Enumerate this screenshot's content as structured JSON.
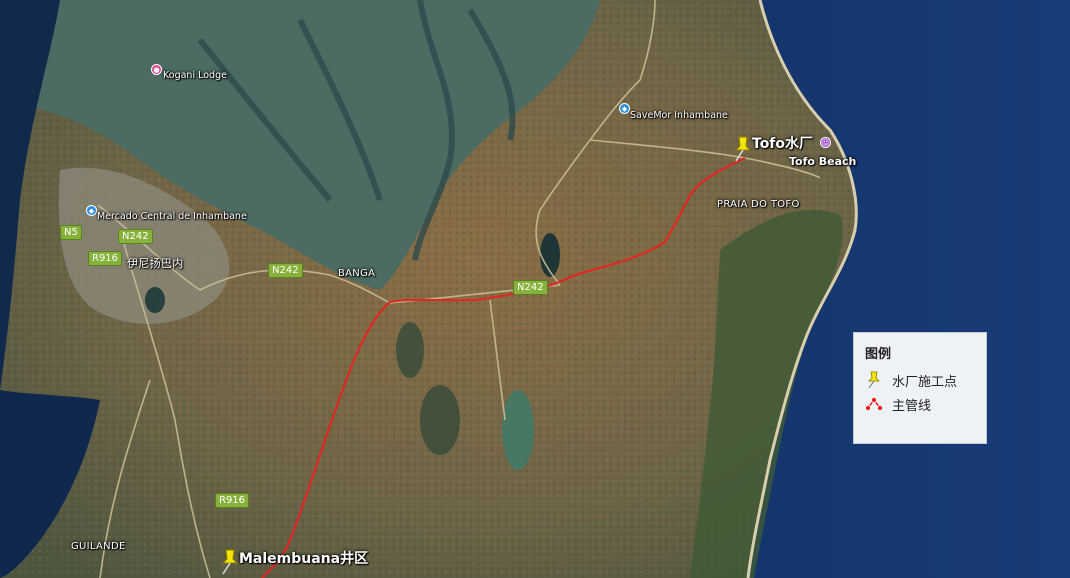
{
  "places": {
    "kogani": "Kogani Lodge",
    "savemor": "SaveMor Inhambane",
    "mercado": "Mercado Central de Inhambane",
    "inhambane": "伊尼扬巴内",
    "banga": "BANGA",
    "praia": "PRAIA DO TOFO",
    "tofo_beach": "Tofo Beach",
    "guilande": "GUILANDE"
  },
  "roads": {
    "n5": "N5",
    "n242_a": "N242",
    "r916_a": "R916",
    "n242_b": "N242",
    "n242_c": "N242",
    "r916_b": "R916"
  },
  "markers": {
    "tofo_plant": "Tofo水厂",
    "malembuana": "Malembuana井区"
  },
  "legend": {
    "title": "图例",
    "items": [
      {
        "label": "水厂施工点",
        "icon": "yellow-pushpin-icon"
      },
      {
        "label": "主管线",
        "icon": "pipeline-line-icon"
      }
    ]
  },
  "colors": {
    "pipeline": "#e8231f",
    "pin": "#f3e600",
    "road_shield": "#86b23c"
  }
}
